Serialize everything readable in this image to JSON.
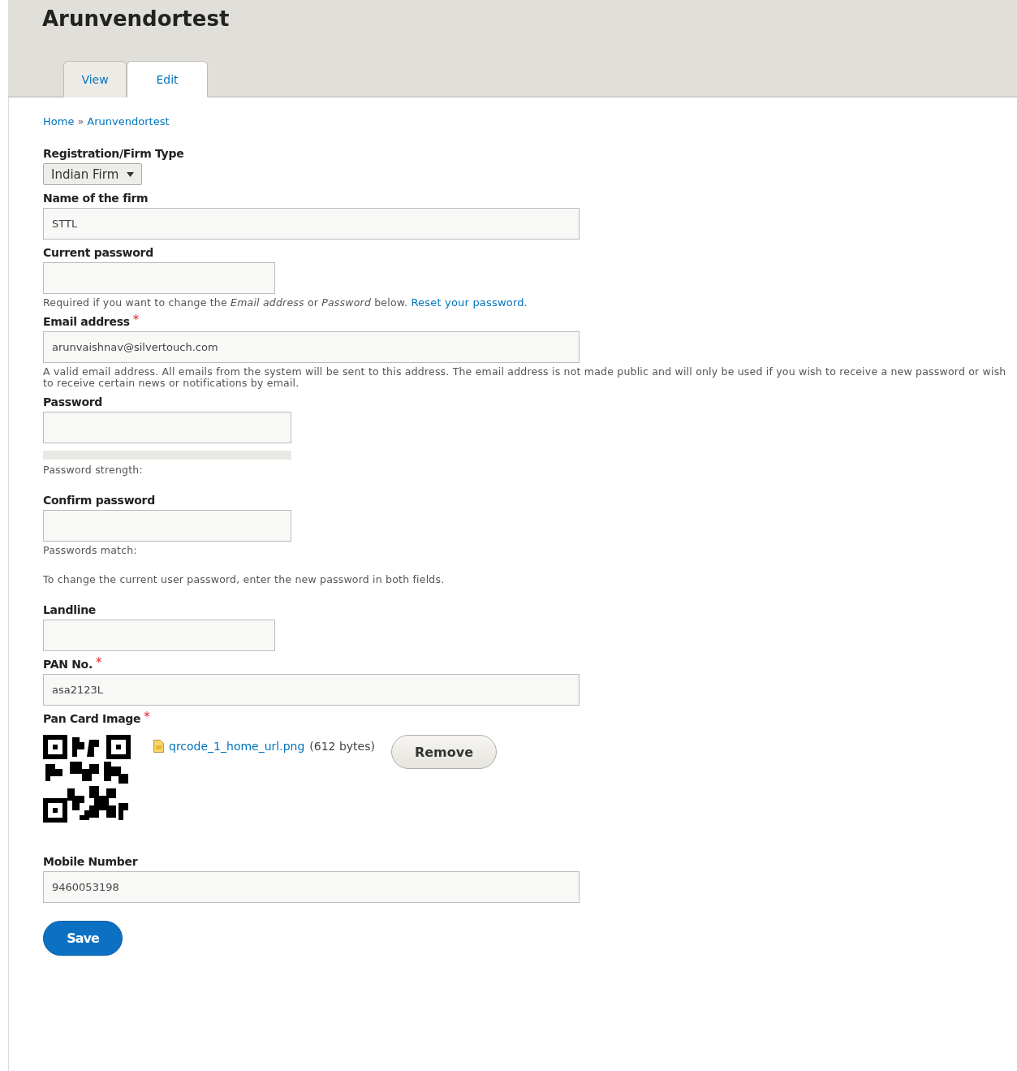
{
  "page": {
    "title": "Arunvendortest"
  },
  "tabs": [
    {
      "label": "View",
      "selected": false
    },
    {
      "label": "Edit",
      "selected": true
    }
  ],
  "breadcrumb": {
    "items": [
      "Home",
      "Arunvendortest"
    ],
    "separator": "»"
  },
  "fields": [
    {
      "kind": "select",
      "label": "Registration/Firm Type",
      "value": "Indian Firm"
    },
    {
      "kind": "text",
      "label": "Name of the firm",
      "value": "STTL"
    },
    {
      "kind": "short-text",
      "label": "Current password",
      "description": "Required if you want to change the *Email address* or *Password* below.",
      "description_link": "Reset your password",
      "description_after": "."
    },
    {
      "kind": "text",
      "label": "Email address",
      "required_mark": "*",
      "value": "arunvaishnav@silvertouch.com",
      "description": "A valid email address. All emails from the system will be sent to this address. The email address is not made public and will only be used if you wish to receive a new password or wish to receive certain news or notifications by email."
    },
    {
      "kind": "password",
      "label": "Password",
      "strength_label": "Password strength:"
    },
    {
      "kind": "confirm",
      "label": "Confirm password",
      "match_label": "Passwords match:",
      "description": "To change the current user password, enter the new password in both fields."
    },
    {
      "kind": "short-text",
      "label": "Landline"
    },
    {
      "kind": "text",
      "label": "PAN No.",
      "required_mark": "*",
      "value": "asa2123L"
    },
    {
      "kind": "file",
      "label": "Pan Card Image",
      "required_mark": "*",
      "file_name": "qrcode_1_home_url.png",
      "file_size": "(612 bytes)",
      "button": "Remove"
    },
    {
      "kind": "text",
      "label": "Mobile Number",
      "value": "9460053198"
    }
  ],
  "submit": "Save"
}
